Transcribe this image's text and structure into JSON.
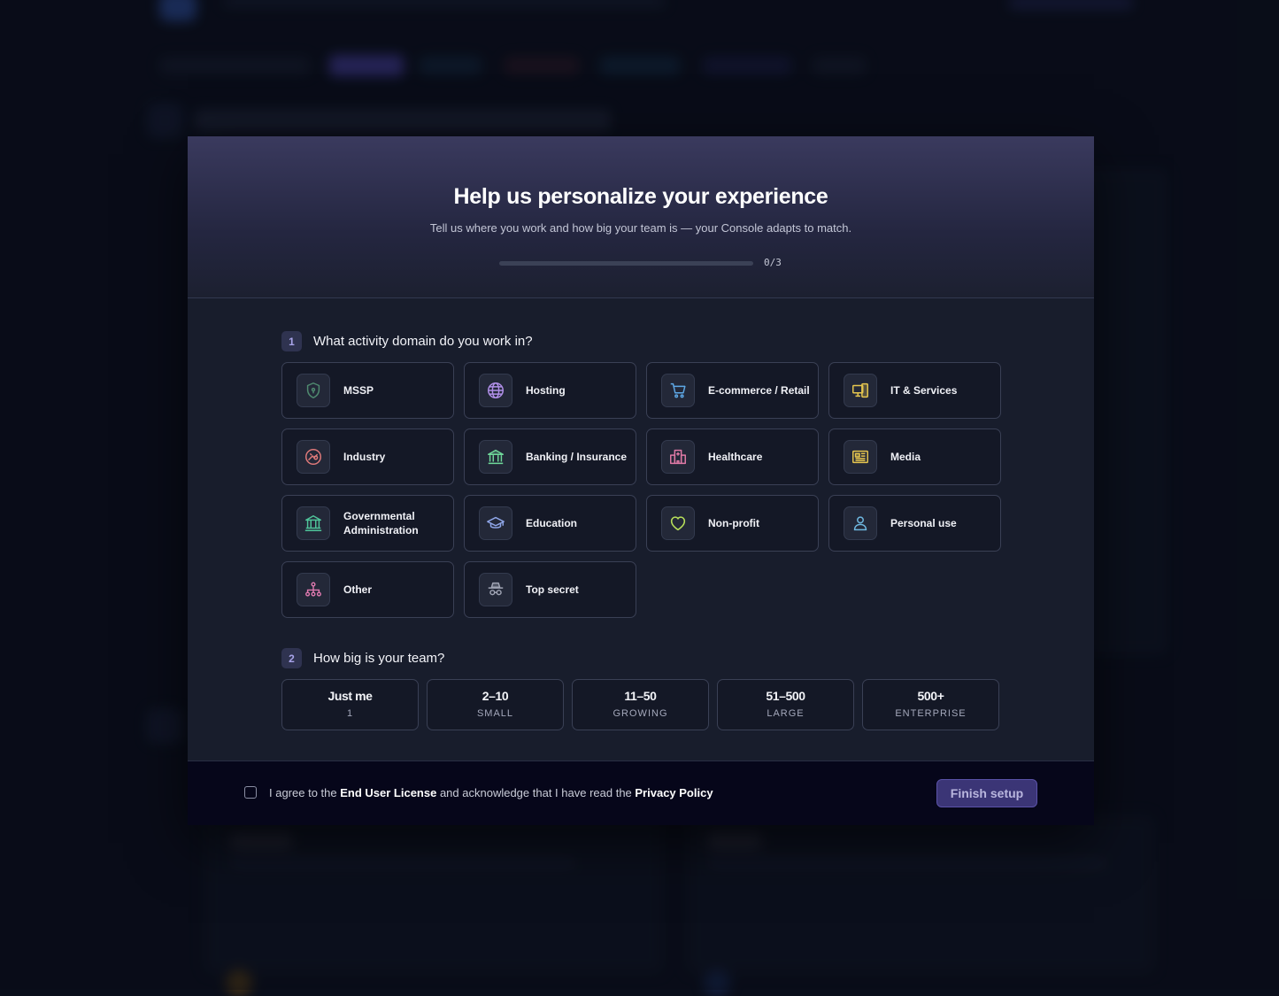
{
  "modal": {
    "title": "Help us personalize your experience",
    "subtitle": "Tell us where you work and how big your team is — your Console adapts to match.",
    "progress": {
      "completed": 0,
      "total": 3,
      "label": "0/3"
    }
  },
  "domain_section": {
    "number": "1",
    "question": "What activity domain do you work in?",
    "options": [
      {
        "label": "MSSP",
        "icon": "shield-icon",
        "color": "#4f8a6f"
      },
      {
        "label": "Hosting",
        "icon": "globe-icon",
        "color": "#b08fe8"
      },
      {
        "label": "E-commerce / Retail",
        "icon": "shopping-cart-icon",
        "color": "#5ea8e6"
      },
      {
        "label": "IT & Services",
        "icon": "devices-icon",
        "color": "#e6c64f"
      },
      {
        "label": "Industry",
        "icon": "industry-icon",
        "color": "#e07a7a"
      },
      {
        "label": "Banking / Insurance",
        "icon": "bank-icon",
        "color": "#6fd89a"
      },
      {
        "label": "Healthcare",
        "icon": "hospital-icon",
        "color": "#e07aa6"
      },
      {
        "label": "Media",
        "icon": "newspaper-icon",
        "color": "#e6c64f"
      },
      {
        "label": "Governmental Administration",
        "icon": "government-icon",
        "color": "#4fc49a"
      },
      {
        "label": "Education",
        "icon": "graduation-cap-icon",
        "color": "#8fa6e8"
      },
      {
        "label": "Non-profit",
        "icon": "heart-icon",
        "color": "#b8e05a"
      },
      {
        "label": "Personal use",
        "icon": "user-icon",
        "color": "#6fb8e0"
      },
      {
        "label": "Other",
        "icon": "network-icon",
        "color": "#e07ab0"
      },
      {
        "label": "Top secret",
        "icon": "spy-icon",
        "color": "#a0a4b4"
      }
    ]
  },
  "team_section": {
    "number": "2",
    "question": "How big is your team?",
    "options": [
      {
        "main": "Just me",
        "sub": "1"
      },
      {
        "main": "2–10",
        "sub": "SMALL"
      },
      {
        "main": "11–50",
        "sub": "GROWING"
      },
      {
        "main": "51–500",
        "sub": "LARGE"
      },
      {
        "main": "500+",
        "sub": "ENTERPRISE"
      }
    ]
  },
  "footer": {
    "agree_prefix": "I agree to the ",
    "eula_link": "End User License",
    "agree_middle": " and acknowledge that I have read the ",
    "privacy_link": "Privacy Policy",
    "finish_label": "Finish setup"
  }
}
